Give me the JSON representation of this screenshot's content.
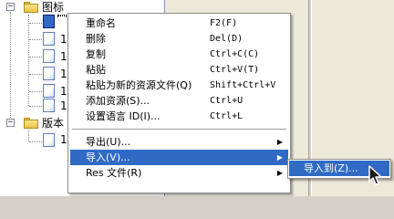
{
  "tree": {
    "root_folder_label": "图标",
    "second_folder_label": "版本",
    "file_stub_label": "1",
    "child_count_first": 7,
    "expanded_symbol": "−"
  },
  "context_menu": {
    "items": [
      {
        "label": "重命名",
        "shortcut": "F2(F)"
      },
      {
        "label": "删除",
        "shortcut": "Del(D)"
      },
      {
        "label": "复制",
        "shortcut": "Ctrl+C(C)"
      },
      {
        "label": "粘贴",
        "shortcut": "Ctrl+V(T)"
      },
      {
        "label": "粘贴为新的资源文件(Q)",
        "shortcut": "Shift+Ctrl+V"
      },
      {
        "label": "添加资源(S)...",
        "shortcut": "Ctrl+U"
      },
      {
        "label": "设置语言 ID(I)...",
        "shortcut": "Ctrl+L"
      }
    ],
    "submenu_items": [
      {
        "label": "导出(U)...",
        "arrow": "▶"
      },
      {
        "label": "导入(V)...",
        "arrow": "▶"
      },
      {
        "label": "Res 文件(R)",
        "arrow": "▶"
      }
    ]
  },
  "import_submenu": {
    "items": [
      {
        "label": "导入到(Z)..."
      }
    ]
  },
  "colors": {
    "highlight": "#316ac5",
    "menu_background": "#ffffff",
    "pane_background": "#ece9d8"
  },
  "icons": [
    "folder-icon",
    "file-icon",
    "expander-minus-icon",
    "submenu-arrow-icon",
    "mouse-pointer-icon"
  ]
}
